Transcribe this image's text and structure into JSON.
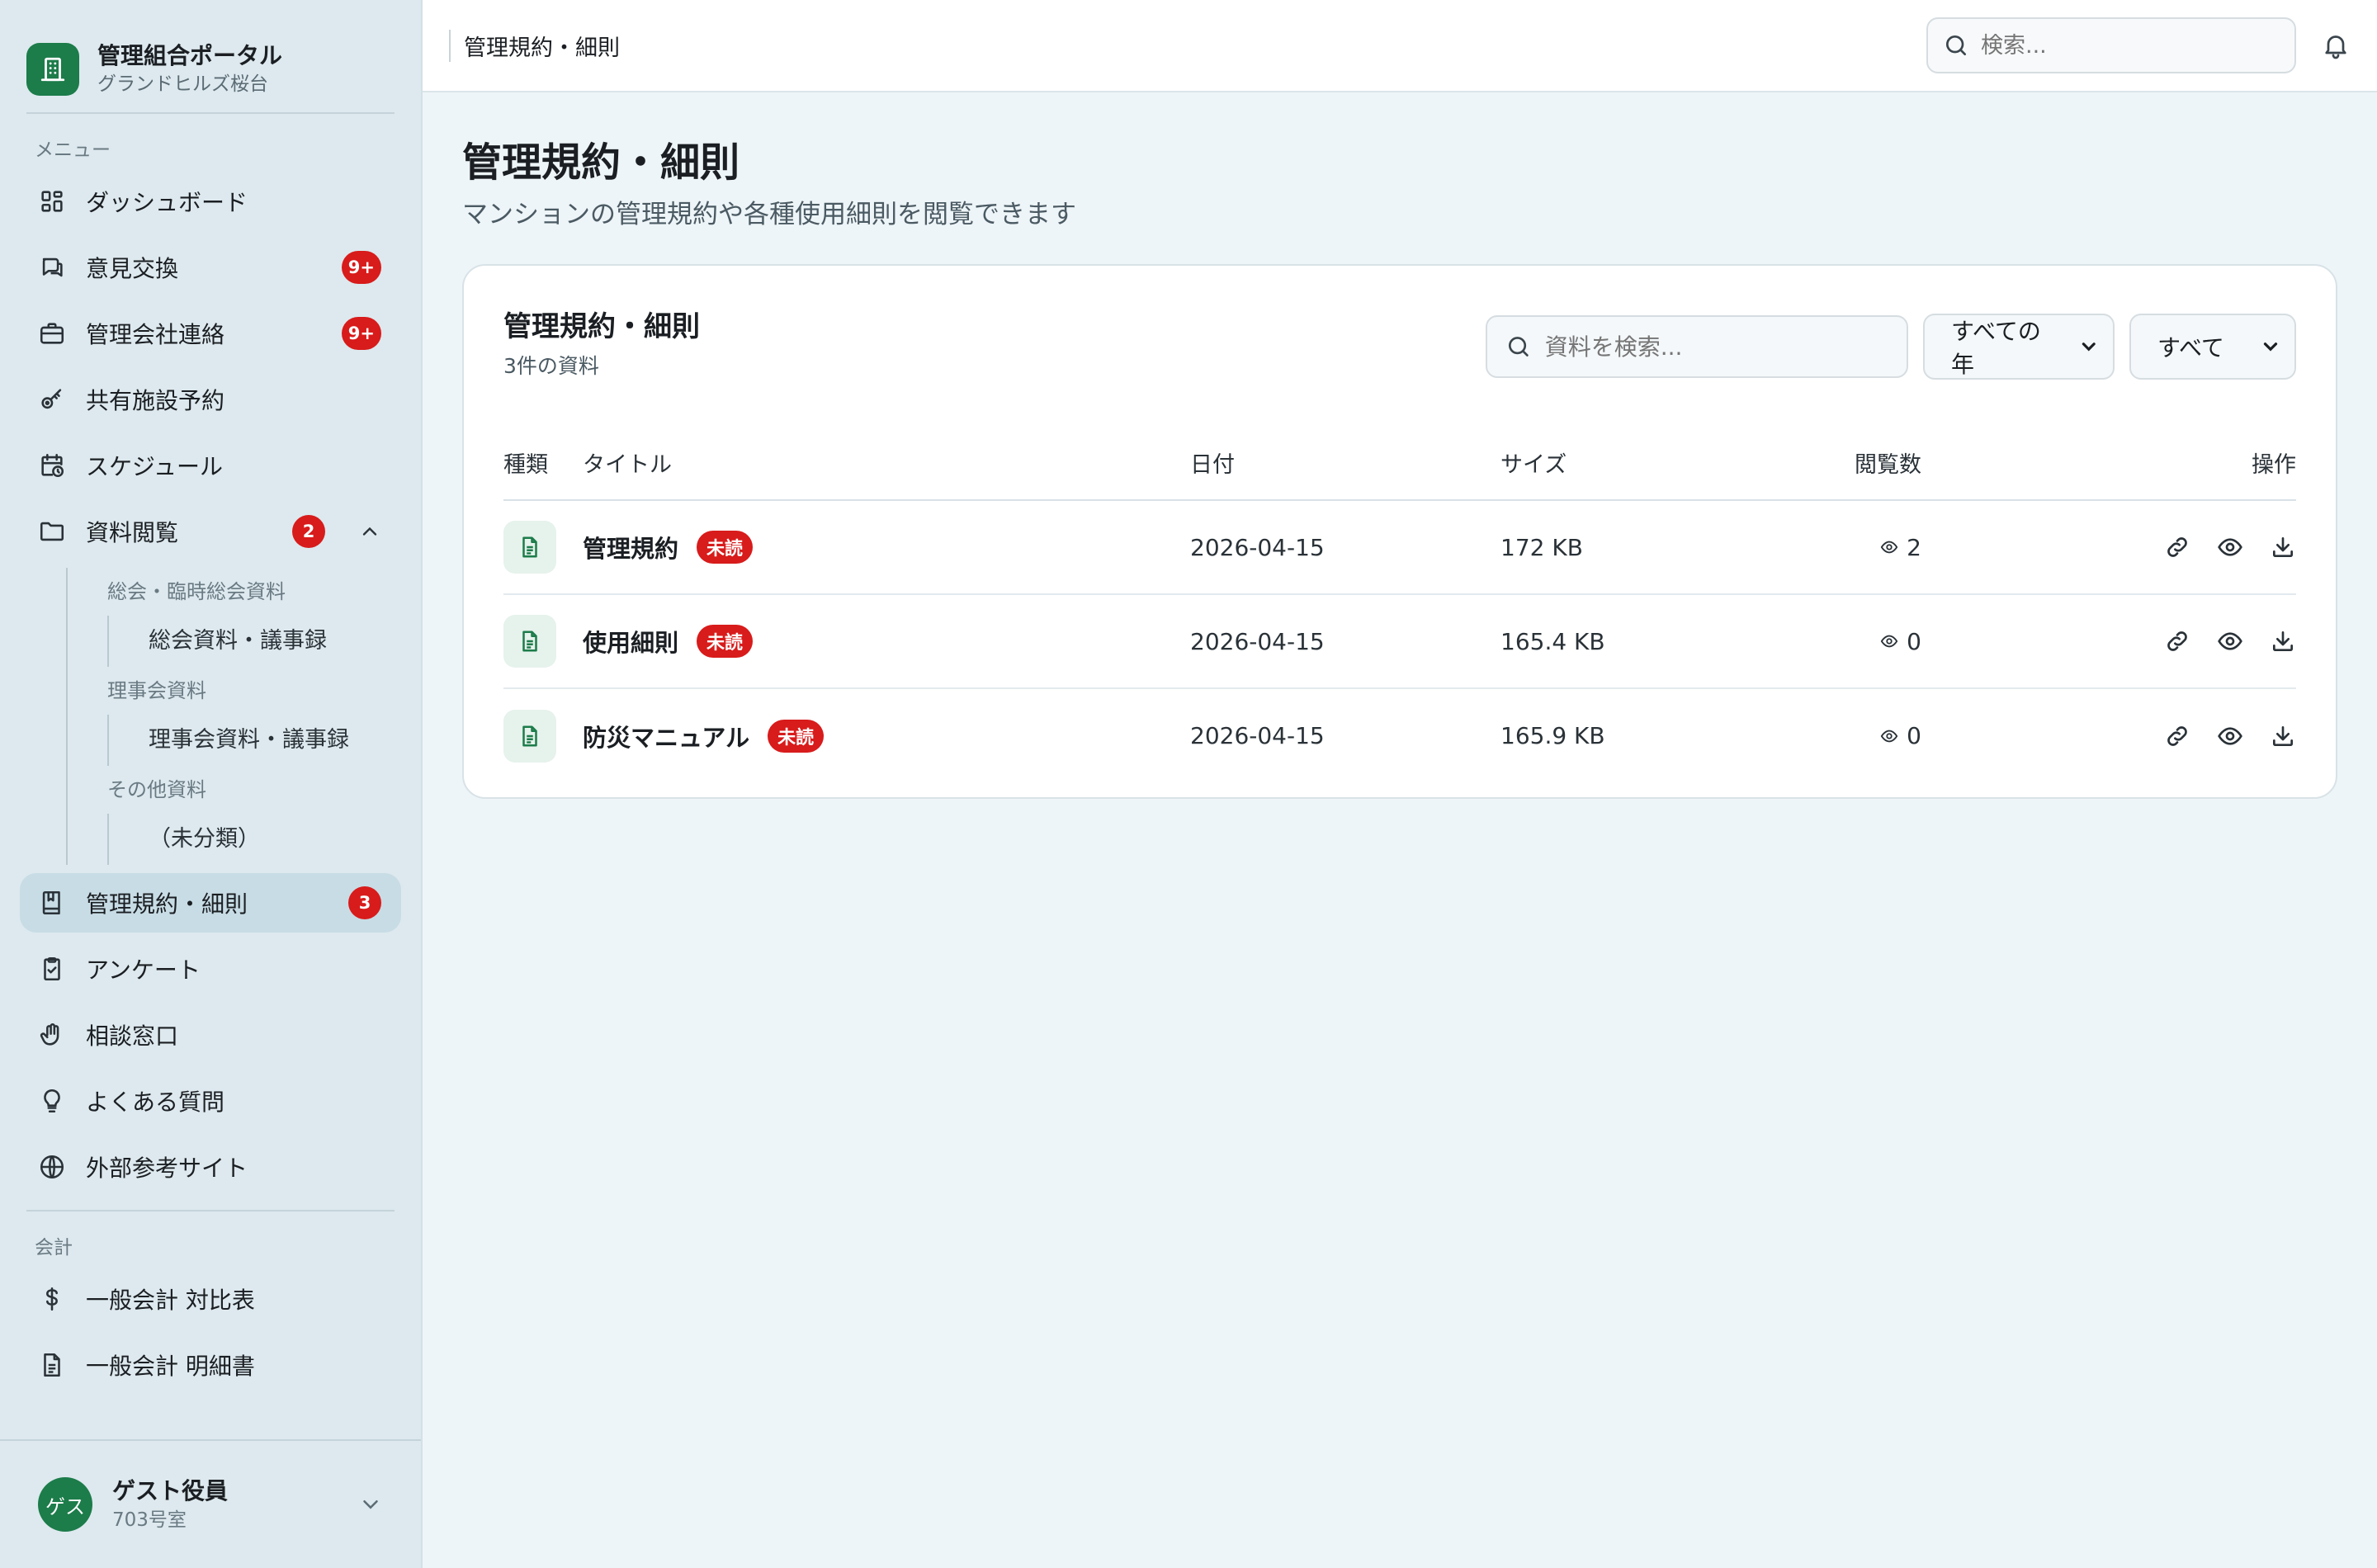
{
  "brand": {
    "title": "管理組合ポータル",
    "subtitle": "グランドヒルズ桜台"
  },
  "sidebar": {
    "menu_label": "メニュー",
    "items": [
      {
        "label": "ダッシュボード",
        "icon": "dashboard-grid-icon"
      },
      {
        "label": "意見交換",
        "icon": "chat-bubble-icon",
        "badge": "9+"
      },
      {
        "label": "管理会社連絡",
        "icon": "briefcase-icon",
        "badge": "9+"
      },
      {
        "label": "共有施設予約",
        "icon": "key-icon"
      },
      {
        "label": "スケジュール",
        "icon": "calendar-clock-icon"
      },
      {
        "label": "資料閲覧",
        "icon": "folder-icon",
        "badge": "2"
      },
      {
        "label": "管理規約・細則",
        "icon": "book-icon",
        "badge": "3"
      },
      {
        "label": "アンケート",
        "icon": "clipboard-check-icon"
      },
      {
        "label": "相談窓口",
        "icon": "hand-icon"
      },
      {
        "label": "よくある質問",
        "icon": "lightbulb-icon"
      },
      {
        "label": "外部参考サイト",
        "icon": "globe-icon"
      }
    ],
    "docs_tree": [
      {
        "group": "総会・臨時総会資料",
        "leaf": "総会資料・議事録"
      },
      {
        "group": "理事会資料",
        "leaf": "理事会資料・議事録"
      },
      {
        "group": "その他資料",
        "leaf": "（未分類）"
      }
    ],
    "accounting_label": "会計",
    "accounting_items": [
      {
        "label": "一般会計 対比表",
        "icon": "dollar-icon"
      },
      {
        "label": "一般会計 明細書",
        "icon": "document-icon"
      }
    ]
  },
  "user": {
    "avatar_text": "ゲス",
    "name": "ゲスト役員",
    "room": "703号室"
  },
  "topbar": {
    "breadcrumb": "管理規約・細則",
    "search_placeholder": "検索..."
  },
  "page": {
    "title": "管理規約・細則",
    "subtitle": "マンションの管理規約や各種使用細則を閲覧できます"
  },
  "card": {
    "title": "管理規約・細則",
    "count": "3件の資料",
    "search_placeholder": "資料を検索...",
    "year_filter": "すべての年",
    "type_filter": "すべて"
  },
  "table": {
    "headers": {
      "type": "種類",
      "title": "タイトル",
      "date": "日付",
      "size": "サイズ",
      "views": "閲覧数",
      "actions": "操作"
    },
    "unread_label": "未読",
    "rows": [
      {
        "title": "管理規約",
        "date": "2026-04-15",
        "size": "172 KB",
        "views": "2"
      },
      {
        "title": "使用細則",
        "date": "2026-04-15",
        "size": "165.4 KB",
        "views": "0"
      },
      {
        "title": "防災マニュアル",
        "date": "2026-04-15",
        "size": "165.9 KB",
        "views": "0"
      }
    ]
  },
  "colors": {
    "brand_green": "#1c7c4a",
    "badge_red": "#d81b1b",
    "sidebar_bg": "#dde9ee",
    "active_bg": "#c8dce5"
  }
}
